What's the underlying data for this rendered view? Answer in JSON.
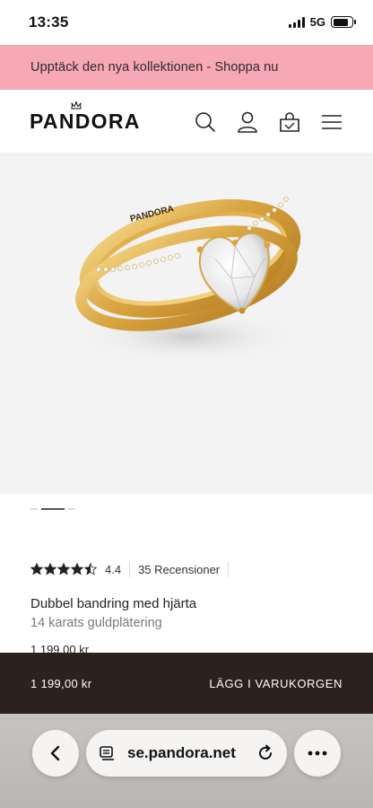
{
  "status_bar": {
    "time": "13:35",
    "network": "5G",
    "battery_level": 0.8
  },
  "promo": {
    "text": "Upptäck den nya kollektionen - Shoppa nu",
    "background": "#f7a8b5"
  },
  "header": {
    "logo": "PANDORA",
    "icons": [
      "search-icon",
      "account-icon",
      "bag-icon",
      "menu-icon"
    ]
  },
  "gallery": {
    "engraving": "PANDORA",
    "slide_count": 3,
    "active_slide": 2
  },
  "product": {
    "rating": "4.4",
    "stars_filled": 4.5,
    "reviews": "35 Recensioner",
    "name": "Dubbel bandring med hjärta",
    "material": "14 karats guldplätering",
    "price": "1 199,00 kr"
  },
  "cart_bar": {
    "price": "1 199,00 kr",
    "button_label": "LÄGG I VARUKORGEN",
    "background": "#2b211d"
  },
  "browser": {
    "url": "se.pandora.net"
  }
}
